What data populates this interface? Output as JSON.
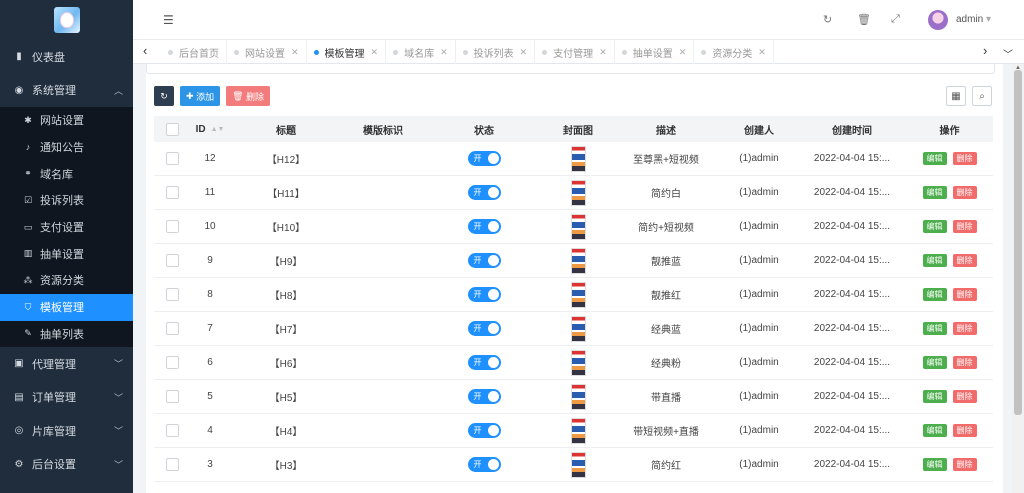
{
  "sidebar": {
    "top": [
      {
        "label": "仪表盘",
        "icon": "dashboard-icon"
      }
    ],
    "group": {
      "label": "系统管理",
      "icon": "settings-icon",
      "expanded": true
    },
    "sub": [
      {
        "label": "网站设置",
        "icon": "asterisk-icon"
      },
      {
        "label": "通知公告",
        "icon": "bell-icon"
      },
      {
        "label": "域名库",
        "icon": "link-icon"
      },
      {
        "label": "投诉列表",
        "icon": "check-square-icon"
      },
      {
        "label": "支付设置",
        "icon": "credit-card-icon"
      },
      {
        "label": "抽单设置",
        "icon": "bars-icon"
      },
      {
        "label": "资源分类",
        "icon": "tree-icon"
      },
      {
        "label": "模板管理",
        "icon": "html5-icon",
        "active": true
      },
      {
        "label": "抽单列表",
        "icon": "pen-icon"
      }
    ],
    "bottom": [
      {
        "label": "代理管理",
        "icon": "user-icon"
      },
      {
        "label": "订单管理",
        "icon": "list-icon"
      },
      {
        "label": "片库管理",
        "icon": "film-icon"
      },
      {
        "label": "后台设置",
        "icon": "cogs-icon"
      }
    ]
  },
  "header": {
    "username": "admin"
  },
  "tabs": [
    {
      "label": "后台首页",
      "closable": false
    },
    {
      "label": "网站设置",
      "closable": true
    },
    {
      "label": "模板管理",
      "closable": true,
      "active": true
    },
    {
      "label": "域名库",
      "closable": true
    },
    {
      "label": "投诉列表",
      "closable": true
    },
    {
      "label": "支付管理",
      "closable": true
    },
    {
      "label": "抽单设置",
      "closable": true
    },
    {
      "label": "资源分类",
      "closable": true
    }
  ],
  "toolbar": {
    "add": "添加",
    "delete": "删除"
  },
  "table": {
    "headers": {
      "id": "ID",
      "title": "标题",
      "mark": "模版标识",
      "status": "状态",
      "cover": "封面图",
      "desc": "描述",
      "creator": "创建人",
      "time": "创建时间",
      "op": "操作"
    },
    "edit_label": "编辑",
    "delete_label": "删除",
    "toggle_label": "开",
    "rows": [
      {
        "id": "12",
        "title": "【H12】",
        "mark": "",
        "desc": "至尊黑+短视频",
        "creator": "(1)admin",
        "time": "2022-04-04 15:..."
      },
      {
        "id": "11",
        "title": "【H11】",
        "mark": "",
        "desc": "简约白",
        "creator": "(1)admin",
        "time": "2022-04-04 15:..."
      },
      {
        "id": "10",
        "title": "【H10】",
        "mark": "",
        "desc": "简约+短视频",
        "creator": "(1)admin",
        "time": "2022-04-04 15:..."
      },
      {
        "id": "9",
        "title": "【H9】",
        "mark": "",
        "desc": "靓推蓝",
        "creator": "(1)admin",
        "time": "2022-04-04 15:..."
      },
      {
        "id": "8",
        "title": "【H8】",
        "mark": "",
        "desc": "靓推红",
        "creator": "(1)admin",
        "time": "2022-04-04 15:..."
      },
      {
        "id": "7",
        "title": "【H7】",
        "mark": "",
        "desc": "经典蓝",
        "creator": "(1)admin",
        "time": "2022-04-04 15:..."
      },
      {
        "id": "6",
        "title": "【H6】",
        "mark": "",
        "desc": "经典粉",
        "creator": "(1)admin",
        "time": "2022-04-04 15:..."
      },
      {
        "id": "5",
        "title": "【H5】",
        "mark": "",
        "desc": "带直播",
        "creator": "(1)admin",
        "time": "2022-04-04 15:..."
      },
      {
        "id": "4",
        "title": "【H4】",
        "mark": "",
        "desc": "带短视频+直播",
        "creator": "(1)admin",
        "time": "2022-04-04 15:..."
      },
      {
        "id": "3",
        "title": "【H3】",
        "mark": "",
        "desc": "简约红",
        "creator": "(1)admin",
        "time": "2022-04-04 15:..."
      }
    ]
  }
}
